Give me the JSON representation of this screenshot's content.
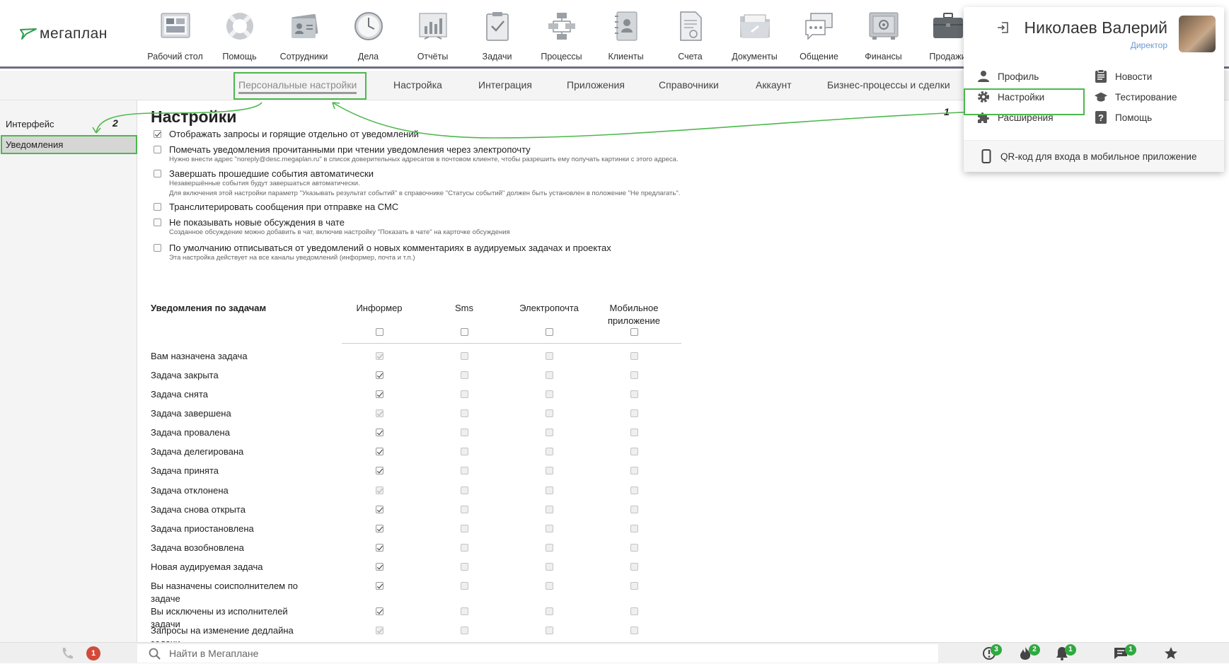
{
  "app": {
    "logo_text": "мегаплан"
  },
  "modules": [
    {
      "label": "Рабочий стол",
      "icon": "desktop-icon"
    },
    {
      "label": "Помощь",
      "icon": "lifebuoy-icon"
    },
    {
      "label": "Сотрудники",
      "icon": "employees-icon"
    },
    {
      "label": "Дела",
      "icon": "clock-icon"
    },
    {
      "label": "Отчёты",
      "icon": "reports-icon"
    },
    {
      "label": "Задачи",
      "icon": "tasks-icon"
    },
    {
      "label": "Процессы",
      "icon": "processes-icon"
    },
    {
      "label": "Клиенты",
      "icon": "clients-icon"
    },
    {
      "label": "Счета",
      "icon": "invoices-icon"
    },
    {
      "label": "Документы",
      "icon": "documents-icon"
    },
    {
      "label": "Общение",
      "icon": "chat-icon"
    },
    {
      "label": "Финансы",
      "icon": "safe-icon"
    },
    {
      "label": "Продажи",
      "icon": "briefcase-icon"
    }
  ],
  "subnav": [
    {
      "label": "Персональные настройки",
      "active": true
    },
    {
      "label": "Настройка"
    },
    {
      "label": "Интеграция"
    },
    {
      "label": "Приложения"
    },
    {
      "label": "Справочники"
    },
    {
      "label": "Аккаунт"
    },
    {
      "label": "Бизнес-процессы и сделки"
    }
  ],
  "sidebar": {
    "items": [
      {
        "label": "Интерфейс"
      },
      {
        "label": "Уведомления",
        "active": true
      }
    ]
  },
  "annotations": {
    "step1": "1",
    "step2": "2",
    "highlight_color": "#4cb84c"
  },
  "page": {
    "title": "Настройки"
  },
  "options": [
    {
      "label": "Отображать запросы и горящие отдельно от уведомлений",
      "checked": true,
      "hints": []
    },
    {
      "label": "Помечать уведомления прочитанными при чтении уведомления через электропочту",
      "checked": false,
      "hints": [
        "Нужно внести адрес \"noreply@desc.megaplan.ru\" в список доверительных адресатов в почтовом клиенте, чтобы разрешить ему получать картинки с этого адреса."
      ]
    },
    {
      "label": "Завершать прошедшие события автоматически",
      "checked": false,
      "hints": [
        "Незавершённые события будут завершаться автоматически.",
        "Для включения этой настройки параметр \"Указывать результат событий\" в справочнике \"Статусы событий\" должен быть установлен в положение \"Не предлагать\"."
      ]
    },
    {
      "label": "Транслитерировать сообщения при отправке на СМС",
      "checked": false,
      "hints": []
    },
    {
      "label": "Не показывать новые обсуждения в чате",
      "checked": false,
      "hints": [
        "Созданное обсуждение можно добавить в чат, включив настройку \"Показать в чате\" на карточке обсуждения"
      ]
    },
    {
      "label": "По умолчанию отписываться от уведомлений о новых комментариях в аудируемых задачах и проектах",
      "checked": false,
      "hints": [
        "Эта настройка действует на все каналы уведомлений (информер, почта и т.п.)"
      ]
    }
  ],
  "task_table": {
    "header": "Уведомления по задачам",
    "columns": [
      "Информер",
      "Sms",
      "Электропочта",
      "Мобильное приложение"
    ],
    "rows": [
      {
        "label": "Вам назначена задача",
        "informer": "disabled-checked"
      },
      {
        "label": "Задача закрыта",
        "informer": "checked"
      },
      {
        "label": "Задача снята",
        "informer": "checked"
      },
      {
        "label": "Задача завершена",
        "informer": "disabled-checked"
      },
      {
        "label": "Задача провалена",
        "informer": "checked"
      },
      {
        "label": "Задача делегирована",
        "informer": "checked"
      },
      {
        "label": "Задача принята",
        "informer": "checked"
      },
      {
        "label": "Задача отклонена",
        "informer": "disabled-checked"
      },
      {
        "label": "Задача снова открыта",
        "informer": "checked"
      },
      {
        "label": "Задача приостановлена",
        "informer": "checked"
      },
      {
        "label": "Задача возобновлена",
        "informer": "checked"
      },
      {
        "label": "Новая аудируемая задача",
        "informer": "checked"
      },
      {
        "label": "Вы назначены соисполнителем по задаче",
        "informer": "checked"
      },
      {
        "label": "Вы исключены из исполнителей задачи",
        "informer": "checked"
      },
      {
        "label": "Запросы на изменение дедлайна задачи",
        "informer": "disabled-checked"
      }
    ]
  },
  "user_menu": {
    "name": "Николаев Валерий",
    "role": "Директор",
    "items": [
      {
        "label": "Профиль",
        "icon": "person-icon"
      },
      {
        "label": "Новости",
        "icon": "news-icon"
      },
      {
        "label": "Настройки",
        "icon": "gear-icon"
      },
      {
        "label": "Тестирование",
        "icon": "graduation-cap-icon"
      },
      {
        "label": "Расширения",
        "icon": "puzzle-icon"
      },
      {
        "label": "Помощь",
        "icon": "question-icon"
      }
    ],
    "footer": "QR-код для входа в мобильное приложение"
  },
  "bottom_bar": {
    "search_placeholder": "Найти в Мегаплане",
    "phone_badge": "1",
    "requests_badge": "3",
    "hot_badge": "2",
    "notifications_badge": "1",
    "messages_badge": "1"
  }
}
